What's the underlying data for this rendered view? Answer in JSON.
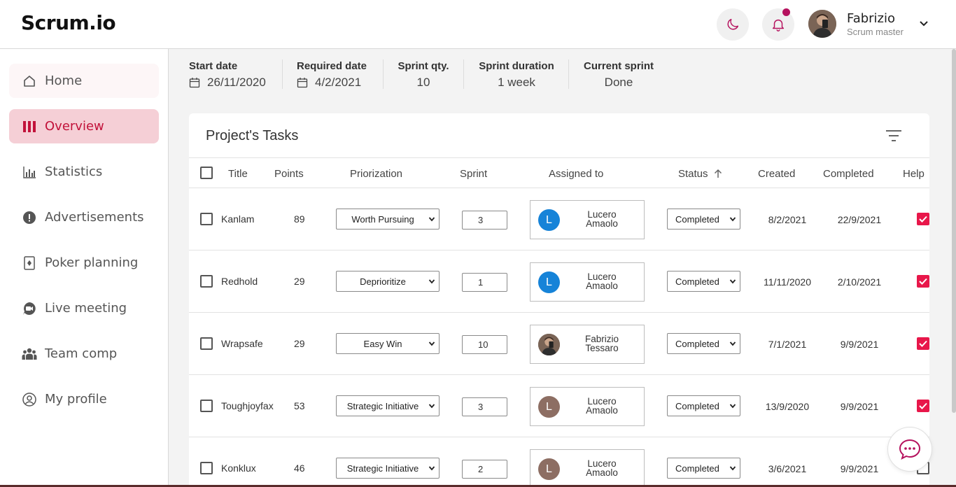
{
  "app": {
    "logo": "Scrum.io"
  },
  "header": {
    "user": {
      "name": "Fabrizio",
      "role": "Scrum master"
    }
  },
  "sidebar": {
    "items": [
      {
        "label": "Home",
        "icon": "home-icon"
      },
      {
        "label": "Overview",
        "icon": "columns-icon",
        "active": true
      },
      {
        "label": "Statistics",
        "icon": "bar-chart-icon"
      },
      {
        "label": "Advertisements",
        "icon": "alert-icon"
      },
      {
        "label": "Poker planning",
        "icon": "card-icon"
      },
      {
        "label": "Live meeting",
        "icon": "video-icon"
      },
      {
        "label": "Team comp",
        "icon": "team-icon"
      },
      {
        "label": "My profile",
        "icon": "user-circle-icon"
      }
    ]
  },
  "sprint_info": {
    "start_date": {
      "label": "Start date",
      "value": "26/11/2020"
    },
    "required_date": {
      "label": "Required date",
      "value": "4/2/2021"
    },
    "sprint_qty": {
      "label": "Sprint qty.",
      "value": "10"
    },
    "sprint_duration": {
      "label": "Sprint duration",
      "value": "1 week"
    },
    "current_sprint": {
      "label": "Current sprint",
      "value": "Done"
    }
  },
  "tasks": {
    "title": "Project's Tasks",
    "columns": {
      "title": "Title",
      "points": "Points",
      "priorization": "Priorization",
      "sprint": "Sprint",
      "assigned": "Assigned to",
      "status": "Status",
      "created": "Created",
      "completed": "Completed",
      "help": "Help"
    },
    "rows": [
      {
        "title": "Kanlam",
        "points": "89",
        "priorization": "Worth Pursuing",
        "sprint": "3",
        "assignee_first": "Lucero",
        "assignee_last": "Amaolo",
        "avatar_letter": "L",
        "avatar_color": "#1683d8",
        "status": "Completed",
        "created": "8/2/2021",
        "completed": "22/9/2021",
        "help": true
      },
      {
        "title": "Redhold",
        "points": "29",
        "priorization": "Deprioritize",
        "sprint": "1",
        "assignee_first": "Lucero",
        "assignee_last": "Amaolo",
        "avatar_letter": "L",
        "avatar_color": "#1683d8",
        "status": "Completed",
        "created": "11/11/2020",
        "completed": "2/10/2021",
        "help": true
      },
      {
        "title": "Wrapsafe",
        "points": "29",
        "priorization": "Easy Win",
        "sprint": "10",
        "assignee_first": "Fabrizio",
        "assignee_last": "Tessaro",
        "avatar_letter": "",
        "avatar_color": "#5e4a3e",
        "status": "Completed",
        "created": "7/1/2021",
        "completed": "9/9/2021",
        "help": true
      },
      {
        "title": "Toughjoyfax",
        "points": "53",
        "priorization": "Strategic Initiative",
        "sprint": "3",
        "assignee_first": "Lucero",
        "assignee_last": "Amaolo",
        "avatar_letter": "L",
        "avatar_color": "#8d6e63",
        "status": "Completed",
        "created": "13/9/2020",
        "completed": "9/9/2021",
        "help": true
      },
      {
        "title": "Konklux",
        "points": "46",
        "priorization": "Strategic Initiative",
        "sprint": "2",
        "assignee_first": "Lucero",
        "assignee_last": "Amaolo",
        "avatar_letter": "L",
        "avatar_color": "#8d6e63",
        "status": "Completed",
        "created": "3/6/2021",
        "completed": "9/9/2021",
        "help": false
      }
    ]
  },
  "colors": {
    "accent": "#c2123a",
    "accent_bg": "#f5cfd6",
    "checkbox": "#e8174a",
    "notification": "#b5125e"
  }
}
